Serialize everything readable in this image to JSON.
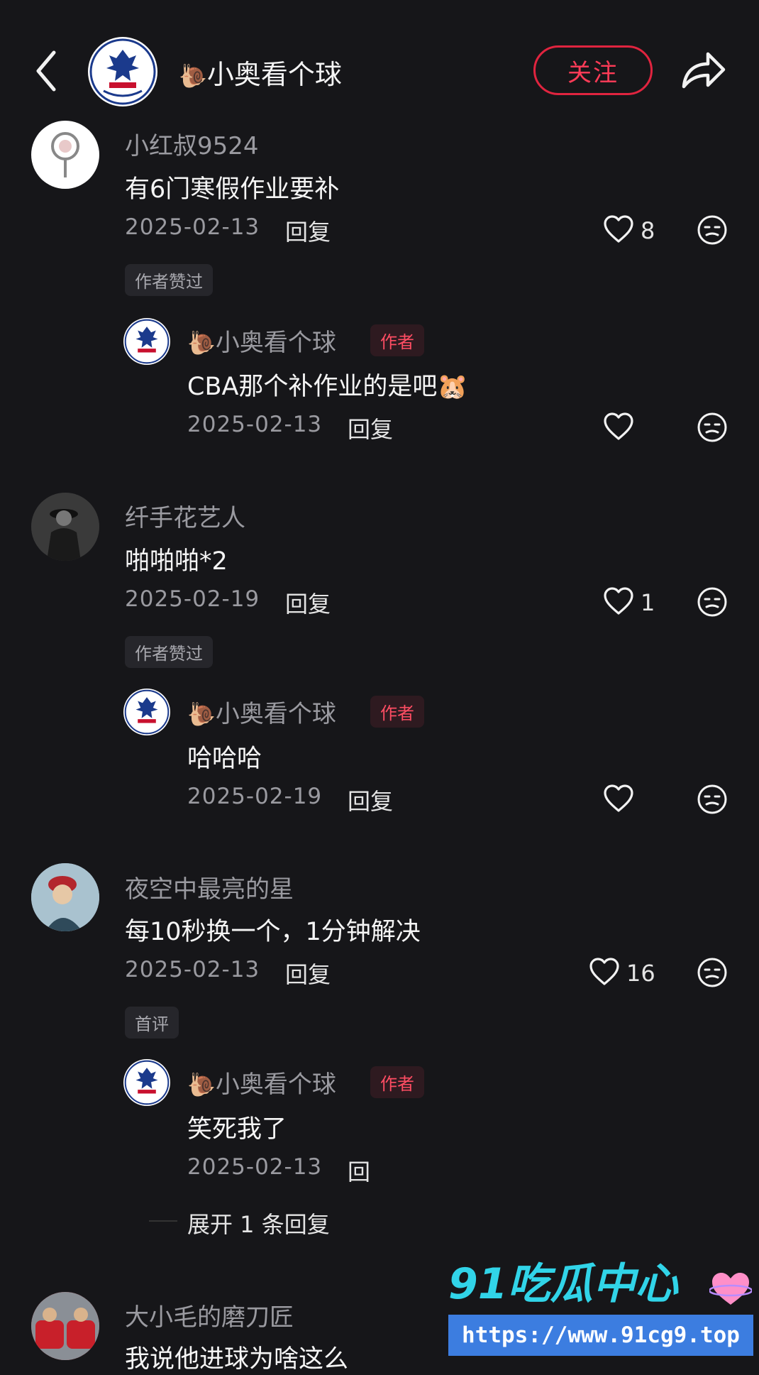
{
  "header": {
    "title_icon": "🐌",
    "title": "小奥看个球",
    "follow_label": "关注"
  },
  "comments": [
    {
      "name": "小红叔9524",
      "text": "有6门寒假作业要补",
      "date": "2025-02-13",
      "reply_label": "回复",
      "likes": "8",
      "tag": "作者赞过",
      "sub": {
        "icon": "🐌",
        "name": "小奥看个球",
        "author_tag": "作者",
        "text": "CBA那个补作业的是吧",
        "emoji": "🐹",
        "date": "2025-02-13",
        "reply_label": "回复"
      }
    },
    {
      "name": "纤手花艺人",
      "text": "啪啪啪*2",
      "date": "2025-02-19",
      "reply_label": "回复",
      "likes": "1",
      "tag": "作者赞过",
      "sub": {
        "icon": "🐌",
        "name": "小奥看个球",
        "author_tag": "作者",
        "text": "哈哈哈",
        "date": "2025-02-19",
        "reply_label": "回复"
      }
    },
    {
      "name": "夜空中最亮的星",
      "text": "每10秒换一个，1分钟解决",
      "date": "2025-02-13",
      "reply_label": "回复",
      "likes": "16",
      "tag": "首评",
      "sub": {
        "icon": "🐌",
        "name": "小奥看个球",
        "author_tag": "作者",
        "text": "笑死我了",
        "date": "2025-02-13",
        "reply_label": "回"
      },
      "expand_label": "展开 1 条回复"
    },
    {
      "name": "大小毛的磨刀匠",
      "text": "我说他进球为啥这么"
    }
  ],
  "watermark": {
    "logo": "91吃瓜中心",
    "url": "https://www.91cg9.top"
  },
  "colors": {
    "background": "#161619",
    "accent": "#e0243f",
    "muted": "#9a9aa0"
  }
}
